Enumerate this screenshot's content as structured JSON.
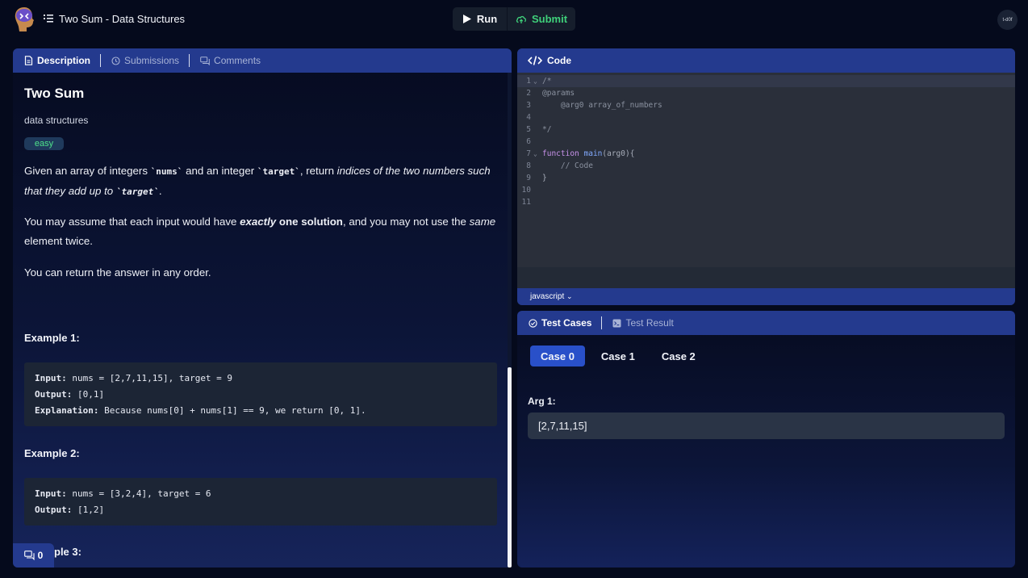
{
  "app": {
    "title": "Two Sum - Data Structures",
    "logo": "brain-logo-icon"
  },
  "toolbar": {
    "run_label": "Run",
    "submit_label": "Submit",
    "avatar_text": "t-d0f"
  },
  "left_tabs": [
    {
      "label": "Description",
      "icon": "document-icon",
      "active": true
    },
    {
      "label": "Submissions",
      "icon": "history-icon",
      "active": false
    },
    {
      "label": "Comments",
      "icon": "comments-icon",
      "active": false
    }
  ],
  "problem": {
    "title": "Two Sum",
    "category": "data structures",
    "difficulty": "easy",
    "p1": {
      "t1": "Given an array of integers ",
      "c1": "`nums`",
      "t2": " and an integer ",
      "c2": "`target`",
      "t3": ", return ",
      "i1": "indices of the two numbers such that they add up to ",
      "c3": "`target`",
      "t4": "."
    },
    "p2": {
      "t1": "You may assume that each input would have ",
      "b1": "exactly",
      "b2": " one solution",
      "t2": ", and you may not use the ",
      "i1": "same",
      "t3": " element twice."
    },
    "p3": "You can return the answer in any order.",
    "examples": [
      {
        "heading": "Example 1:",
        "input_label": "Input:",
        "input": " nums = [2,7,11,15], target = 9",
        "output_label": "Output:",
        "output": " [0,1]",
        "explanation_label": "Explanation:",
        "explanation": " Because nums[0] + nums[1] == 9, we return [0, 1]."
      },
      {
        "heading": "Example 2:",
        "input_label": "Input:",
        "input": " nums = [3,2,4], target = 6",
        "output_label": "Output:",
        "output": " [1,2]"
      }
    ],
    "example3_partial": "ple 3:"
  },
  "comments_badge": {
    "count": "0",
    "icon": "comments-icon"
  },
  "code": {
    "header": "Code",
    "language": "javascript",
    "lines": [
      {
        "n": "1",
        "fold": true,
        "text": "/*"
      },
      {
        "n": "2",
        "fold": false,
        "text": "@params"
      },
      {
        "n": "3",
        "fold": false,
        "text": "    @arg0 array_of_numbers"
      },
      {
        "n": "4",
        "fold": false,
        "text": ""
      },
      {
        "n": "5",
        "fold": false,
        "text": "*/"
      },
      {
        "n": "6",
        "fold": false,
        "text": ""
      },
      {
        "n": "7",
        "fold": true,
        "kw": "function",
        "fn": "main",
        "rest": "(arg0){"
      },
      {
        "n": "8",
        "fold": false,
        "text": "    // Code"
      },
      {
        "n": "9",
        "fold": false,
        "text": "}"
      },
      {
        "n": "10",
        "fold": false,
        "text": ""
      },
      {
        "n": "11",
        "fold": false,
        "text": ""
      }
    ]
  },
  "tests": {
    "tabs": [
      {
        "label": "Test Cases",
        "icon": "check-circle-icon",
        "active": true
      },
      {
        "label": "Test Result",
        "icon": "terminal-icon",
        "active": false
      }
    ],
    "cases": [
      "Case 0",
      "Case 1",
      "Case 2"
    ],
    "active_case": 0,
    "arg_label": "Arg 1:",
    "arg_value": "[2,7,11,15]"
  }
}
